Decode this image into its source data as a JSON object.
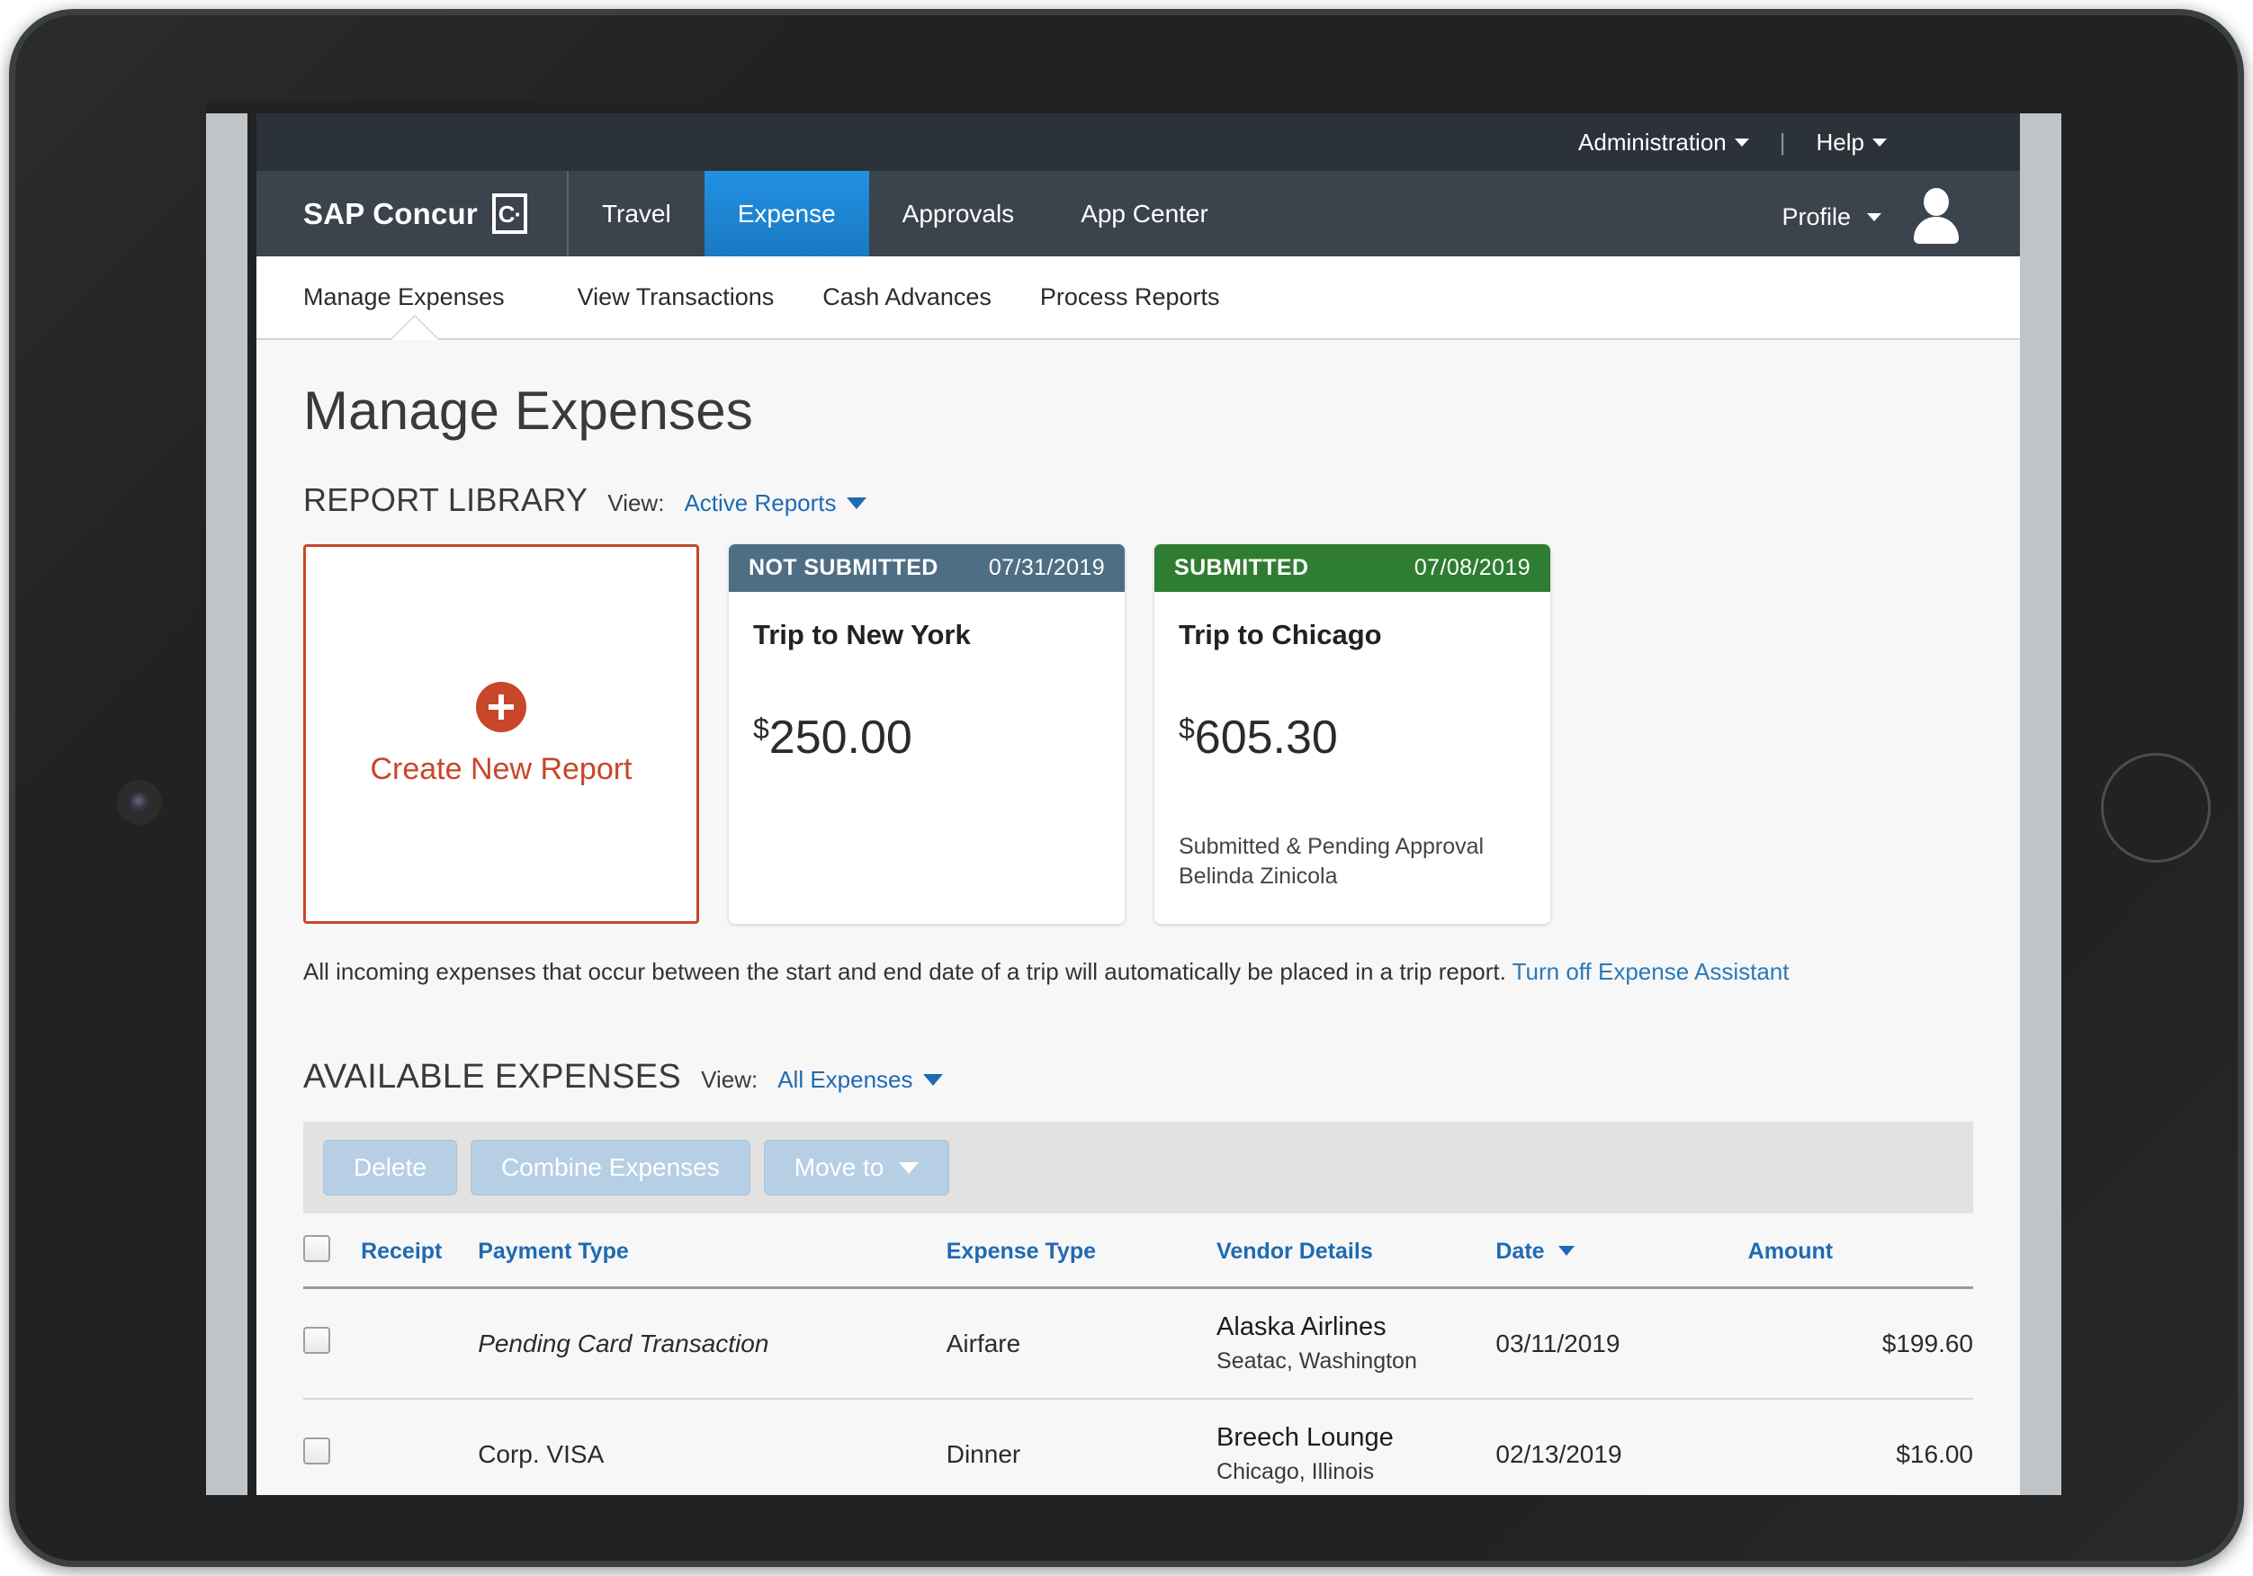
{
  "brand": {
    "name": "SAP Concur",
    "mark": "C·"
  },
  "admin_bar": {
    "administration": "Administration",
    "separator": "|",
    "help": "Help"
  },
  "nav": {
    "items": [
      {
        "label": "Travel",
        "active": false
      },
      {
        "label": "Expense",
        "active": true
      },
      {
        "label": "Approvals",
        "active": false
      },
      {
        "label": "App Center",
        "active": false
      }
    ],
    "profile": "Profile"
  },
  "sub_nav": {
    "items": [
      {
        "label": "Manage Expenses",
        "active": true
      },
      {
        "label": "View Transactions",
        "active": false
      },
      {
        "label": "Cash Advances",
        "active": false
      },
      {
        "label": "Process Reports",
        "active": false
      }
    ]
  },
  "page": {
    "title": "Manage Expenses"
  },
  "report_library": {
    "title": "REPORT LIBRARY",
    "view_label": "View:",
    "view_value": "Active Reports",
    "create_card": {
      "label": "Create New Report"
    },
    "cards": [
      {
        "status": "NOT SUBMITTED",
        "status_color": "#4e6e84",
        "date": "07/31/2019",
        "name": "Trip to New York",
        "currency": "$",
        "amount": "250.00",
        "note": ""
      },
      {
        "status": "SUBMITTED",
        "status_color": "#2f7d32",
        "date": "07/08/2019",
        "name": "Trip to Chicago",
        "currency": "$",
        "amount": "605.30",
        "note_line1": "Submitted & Pending Approval",
        "note_line2": "Belinda Zinicola"
      }
    ],
    "assistant_text": "All incoming expenses that occur between the start and end date of a trip will automatically be placed in a trip report.",
    "assistant_link": "Turn off Expense Assistant"
  },
  "available_expenses": {
    "title": "AVAILABLE EXPENSES",
    "view_label": "View:",
    "view_value": "All Expenses",
    "toolbar": {
      "delete": "Delete",
      "combine": "Combine Expenses",
      "move_to": "Move to"
    },
    "columns": {
      "receipt": "Receipt",
      "payment_type": "Payment Type",
      "expense_type": "Expense Type",
      "vendor_details": "Vendor Details",
      "date": "Date",
      "amount": "Amount"
    },
    "sort": {
      "column": "Date",
      "direction": "desc"
    },
    "rows": [
      {
        "payment_type": "Pending Card Transaction",
        "payment_italic": true,
        "expense_type": "Airfare",
        "vendor_name": "Alaska Airlines",
        "vendor_location": "Seatac, Washington",
        "date": "03/11/2019",
        "amount": "$199.60"
      },
      {
        "payment_type": "Corp. VISA",
        "payment_italic": false,
        "expense_type": "Dinner",
        "vendor_name": "Breech Lounge",
        "vendor_location": "Chicago, Illinois",
        "date": "02/13/2019",
        "amount": "$16.00"
      }
    ]
  },
  "colors": {
    "nav_bg": "#3b434d",
    "admin_bg": "#2c3239",
    "accent_blue": "#1f6ab2",
    "active_tab": "#1a79c4",
    "brand_orange": "#c8462a",
    "submitted_green": "#2f7d32",
    "not_submitted_slate": "#4e6e84"
  }
}
